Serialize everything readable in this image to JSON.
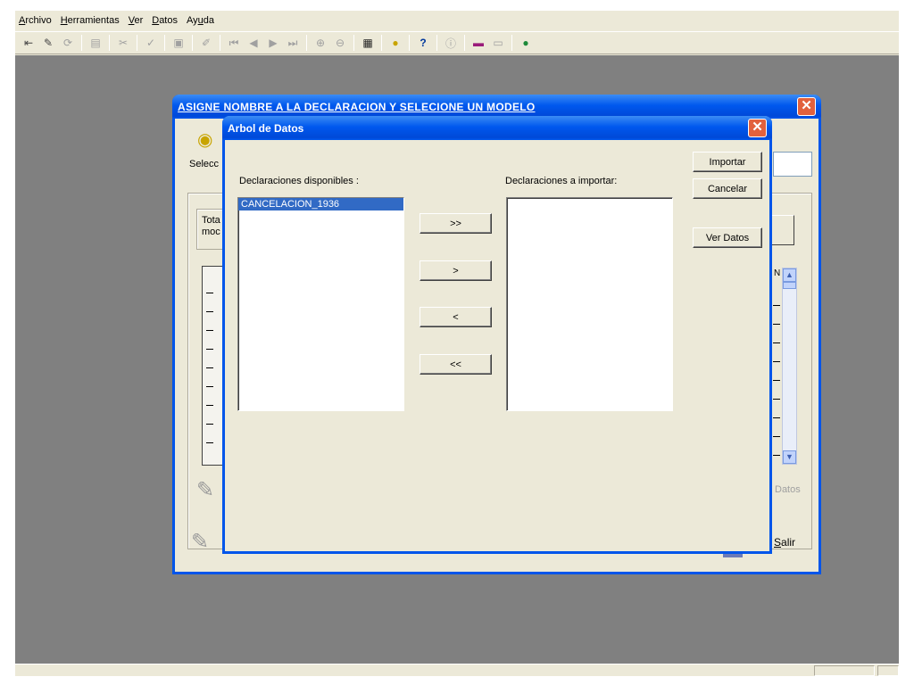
{
  "menu": [
    {
      "label": "Archivo"
    },
    {
      "label": "Herramientas"
    },
    {
      "label": "Ver"
    },
    {
      "label": "Datos"
    },
    {
      "label": "Ayuda"
    }
  ],
  "toolbar_icons": [
    "exit-icon",
    "edit-icon",
    "refresh-icon",
    "save-icon",
    "cut-icon",
    "check-icon",
    "print-icon",
    "erase-icon",
    "first-icon",
    "previous-icon",
    "next-icon",
    "last-icon",
    "zoom-in-icon",
    "zoom-out-icon",
    "calculator-icon",
    "info-badge-icon",
    "help-icon",
    "information-icon",
    "printer-icon",
    "disk-icon",
    "globe-icon"
  ],
  "background_window": {
    "title": "ASIGNE NOMBRE A LA DECLARACION Y SELECIONE UN MODELO",
    "select_label": "Selecc",
    "total_label_1": "Tota",
    "total_label_2": "moc",
    "col_fragment": "N",
    "datos_label": "Datos",
    "salir_label": "Salir"
  },
  "dialog": {
    "title": "Arbol de Datos",
    "available_label": "Declaraciones disponibles :",
    "import_label": "Declaraciones a importar:",
    "available_items": [
      "CANCELACION_1936"
    ],
    "selected_item": "CANCELACION_1936",
    "import_items": [],
    "move_all_right": ">>",
    "move_right": ">",
    "move_left": "<",
    "move_all_left": "<<",
    "importar": "Importar",
    "cancelar": "Cancelar",
    "ver_datos": "Ver Datos"
  }
}
